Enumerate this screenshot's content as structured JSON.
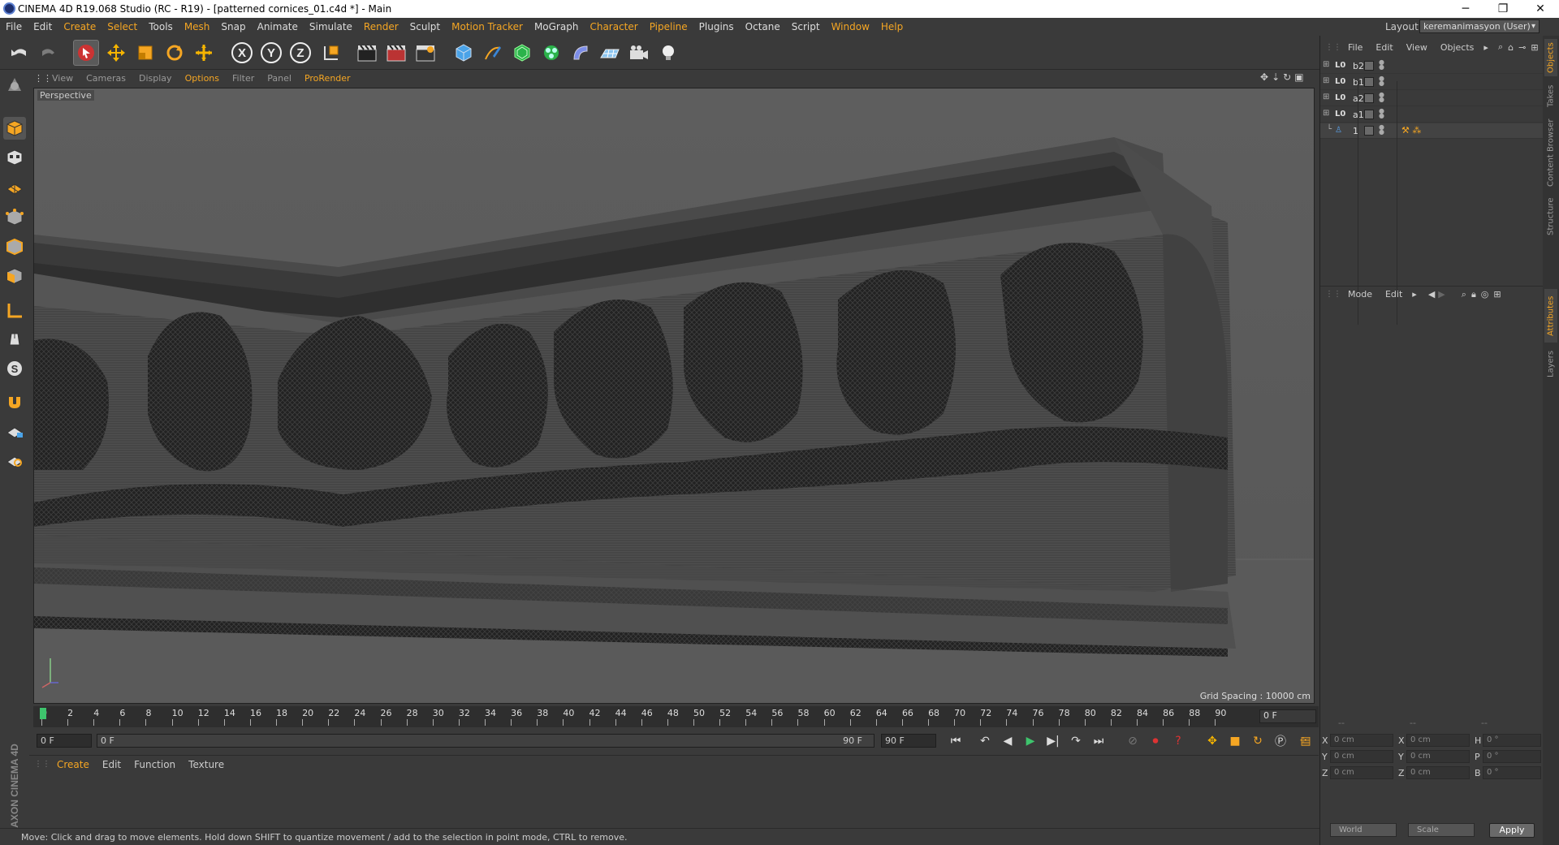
{
  "window": {
    "title": "CINEMA 4D R19.068 Studio (RC - R19) - [patterned cornices_01.c4d *] - Main",
    "minimize": "─",
    "restore": "❐",
    "close": "✕"
  },
  "menu": [
    "File",
    "Edit",
    "Create",
    "Select",
    "Tools",
    "Mesh",
    "Snap",
    "Animate",
    "Simulate",
    "Render",
    "Sculpt",
    "Motion Tracker",
    "MoGraph",
    "Character",
    "Pipeline",
    "Plugins",
    "Octane",
    "Script",
    "Window",
    "Help"
  ],
  "layout": {
    "label": "Layout:",
    "value": "keremanimasyon (User)"
  },
  "toolbar": {
    "x_axis": "X",
    "y_axis": "Y",
    "z_axis": "Z"
  },
  "viewport": {
    "menu": [
      "View",
      "Cameras",
      "Display",
      "Options",
      "Filter",
      "Panel",
      "ProRender"
    ],
    "label": "Perspective",
    "grid_spacing": "Grid Spacing : 10000 cm"
  },
  "timeline": {
    "ticks": [
      "0",
      "2",
      "4",
      "6",
      "8",
      "10",
      "12",
      "14",
      "16",
      "18",
      "20",
      "22",
      "24",
      "26",
      "28",
      "30",
      "32",
      "34",
      "36",
      "38",
      "40",
      "42",
      "44",
      "46",
      "48",
      "50",
      "52",
      "54",
      "56",
      "58",
      "60",
      "62",
      "64",
      "66",
      "68",
      "70",
      "72",
      "74",
      "76",
      "78",
      "80",
      "82",
      "84",
      "86",
      "88",
      "90"
    ],
    "end_field": "0 F"
  },
  "transport": {
    "start": "0 F",
    "range_start": "0 F",
    "range_end": "90 F",
    "end": "90 F"
  },
  "material": {
    "menu": [
      "Create",
      "Edit",
      "Function",
      "Texture"
    ]
  },
  "status": "Move: Click and drag to move elements. Hold down SHIFT to quantize movement / add to the selection in point mode, CTRL to remove.",
  "logo": "MAXON CINEMA 4D",
  "objects": {
    "menu": [
      "File",
      "Edit",
      "View",
      "Objects"
    ],
    "rows": [
      {
        "name": "b2"
      },
      {
        "name": "b1"
      },
      {
        "name": "a2"
      },
      {
        "name": "a1"
      },
      {
        "name": "1"
      }
    ]
  },
  "attributes": {
    "menu": [
      "Mode",
      "Edit"
    ]
  },
  "coords": {
    "headers": [
      "--",
      "--",
      "--"
    ],
    "rows": [
      {
        "l1": "X",
        "v1": "0 cm",
        "l2": "X",
        "v2": "0 cm",
        "l3": "H",
        "v3": "0 °"
      },
      {
        "l1": "Y",
        "v1": "0 cm",
        "l2": "Y",
        "v2": "0 cm",
        "l3": "P",
        "v3": "0 °"
      },
      {
        "l1": "Z",
        "v1": "0 cm",
        "l2": "Z",
        "v2": "0 cm",
        "l3": "B",
        "v3": "0 °"
      }
    ],
    "space": "World",
    "mode": "Scale",
    "apply": "Apply"
  },
  "side_tabs": [
    "Objects",
    "Takes",
    "Content Browser",
    "Structure",
    "Attributes",
    "Layers"
  ],
  "colors": {
    "accent": "#f5a623",
    "panel": "#3a3a3a",
    "viewport": "#5c5c5c",
    "playhead": "#3ec46d"
  }
}
